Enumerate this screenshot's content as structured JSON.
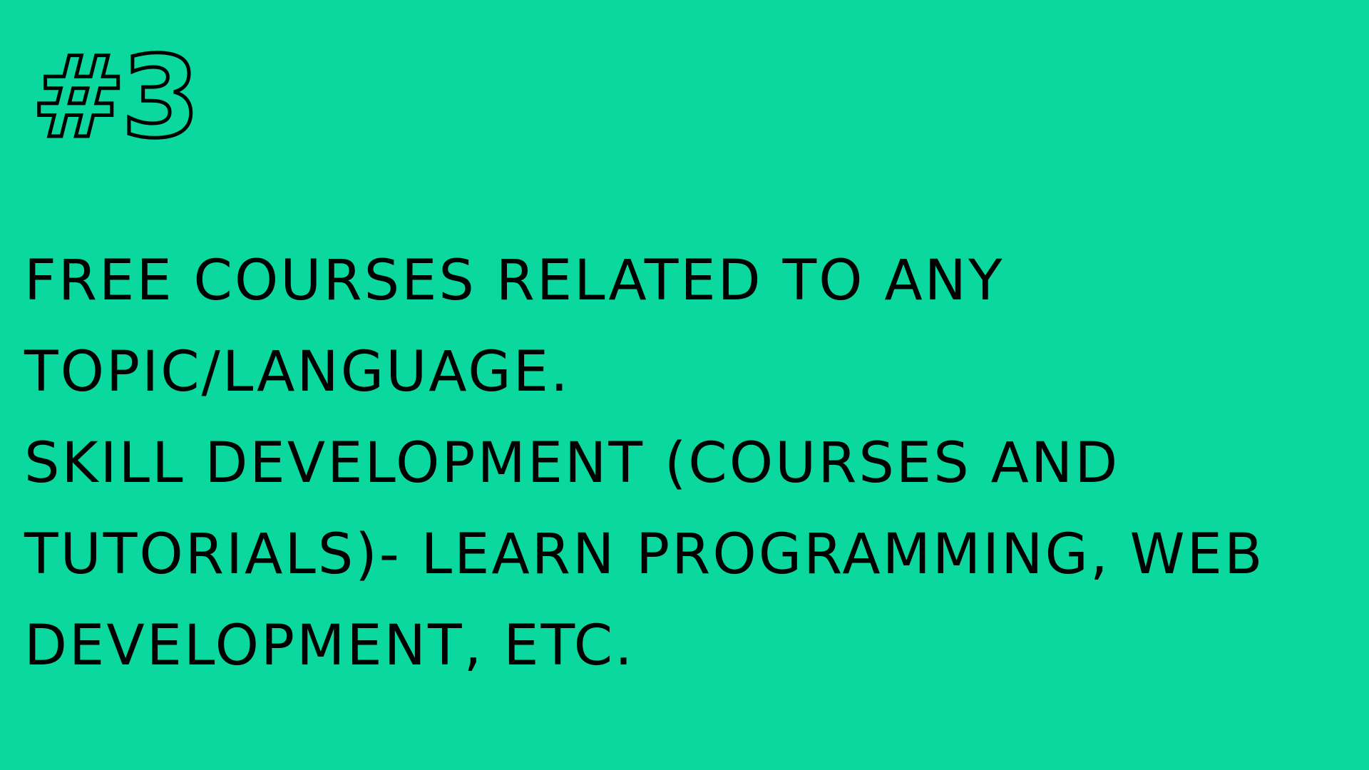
{
  "slide": {
    "background_color": "#0bd89e",
    "text_color": "#000000",
    "heading": "#3",
    "lines": [
      "FREE COURSES RELATED TO ANY",
      "TOPIC/LANGUAGE.",
      "SKILL DEVELOPMENT (COURSES AND",
      "TUTORIALS)- LEARN PROGRAMMING, WEB",
      "DEVELOPMENT, ETC."
    ]
  }
}
